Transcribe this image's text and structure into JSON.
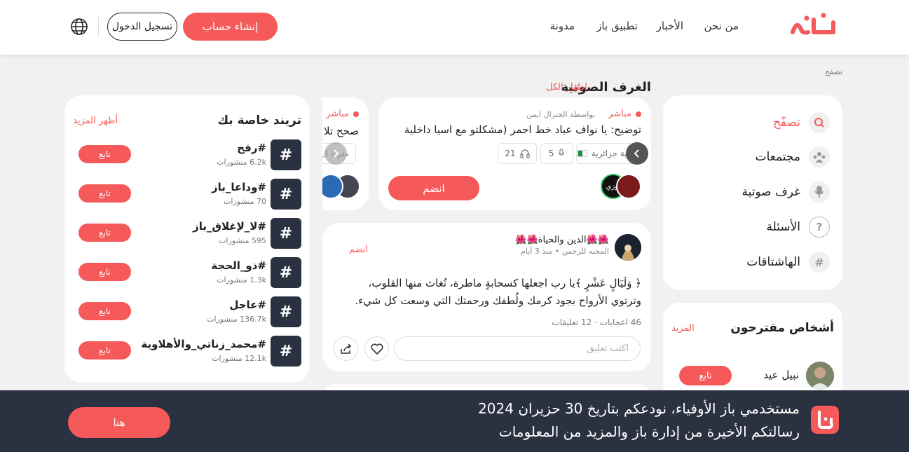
{
  "brand": {
    "accent": "#f65959",
    "dark": "#2a3140"
  },
  "header": {
    "nav": [
      "من نحن",
      "الأخبار",
      "تطبيق باز",
      "مدونة"
    ],
    "signup_label": "إنشاء حساب",
    "login_label": "تسجيل الدخول",
    "language_icon": "globe-icon"
  },
  "breadcrumb": "تصفح",
  "sidebar": {
    "items": [
      {
        "label": "تصفّح",
        "icon": "search-icon",
        "active": true
      },
      {
        "label": "مجتمعات",
        "icon": "community-icon"
      },
      {
        "label": "غرف صوتية",
        "icon": "microphone-icon"
      },
      {
        "label": "الأسئلة",
        "icon": "question-icon"
      },
      {
        "label": "الهاشتاقات",
        "icon": "hashtag-icon"
      }
    ]
  },
  "suggested": {
    "title": "أشخاص مقترحون",
    "more": "المزيد",
    "people": [
      {
        "name": "نبيل عيد",
        "follow": "تابع"
      }
    ]
  },
  "voice_rooms": {
    "title": "الغرف الصوتية",
    "show_all": "إظهار الكل",
    "rooms": [
      {
        "live": "مباشر",
        "by": "بواسطة الجنرال ايمن",
        "text": "توضيح: يا نواف عياد خط احمر (مشكلتو مع اسيا داخلية",
        "tag": "عقلية جزائرية",
        "speakers": "5",
        "listeners": "21",
        "join": "انضم"
      },
      {
        "live": "مباشر",
        "text": "صحح تلا",
        "tag": "مقراة ال"
      }
    ]
  },
  "post": {
    "author": "🌺🌺الدين والحياة🌺🌺",
    "community": "المحبه للرحمن",
    "time": "منذ 3 أيام",
    "join": "انضم",
    "text": "﴿ وَلَيَالٍ عَشْرٍ ﴾يا رب اجعلها كسحابةٍ ماطرة، تُغاث منها القلوب، وترتوي الأرواح بجود كرمك ولُطفك ورحمتك التي وسعت كل شيء.",
    "stats": "46 اعجابات · 12 تعليقات",
    "comment_placeholder": "اكتب تعليق"
  },
  "trends": {
    "title": "تريند خاصة بك",
    "more": "أظهر المزيد",
    "follow": "تابع",
    "items": [
      {
        "tag": "#رفح",
        "count": "6.2k منشورات"
      },
      {
        "tag": "#وداعا_باز",
        "count": "70 منشورات"
      },
      {
        "tag": "#لا_لإغلاق_باز",
        "count": "595 منشورات"
      },
      {
        "tag": "#ذو_الحجة",
        "count": "1.3k منشورات"
      },
      {
        "tag": "#عاجل",
        "count": "136.7k منشورات"
      },
      {
        "tag": "#محمد_زناتي_والأهلاوية",
        "count": "12.1k منشورات"
      }
    ]
  },
  "banner": {
    "line1": "مستخدمي باز الأوفياء، نودعكم بتاريخ 30 حزيران 2024",
    "line2": "رسالتكم الأخيرة من إدارة باز والمزيد من المعلومات",
    "button": "هنا"
  }
}
